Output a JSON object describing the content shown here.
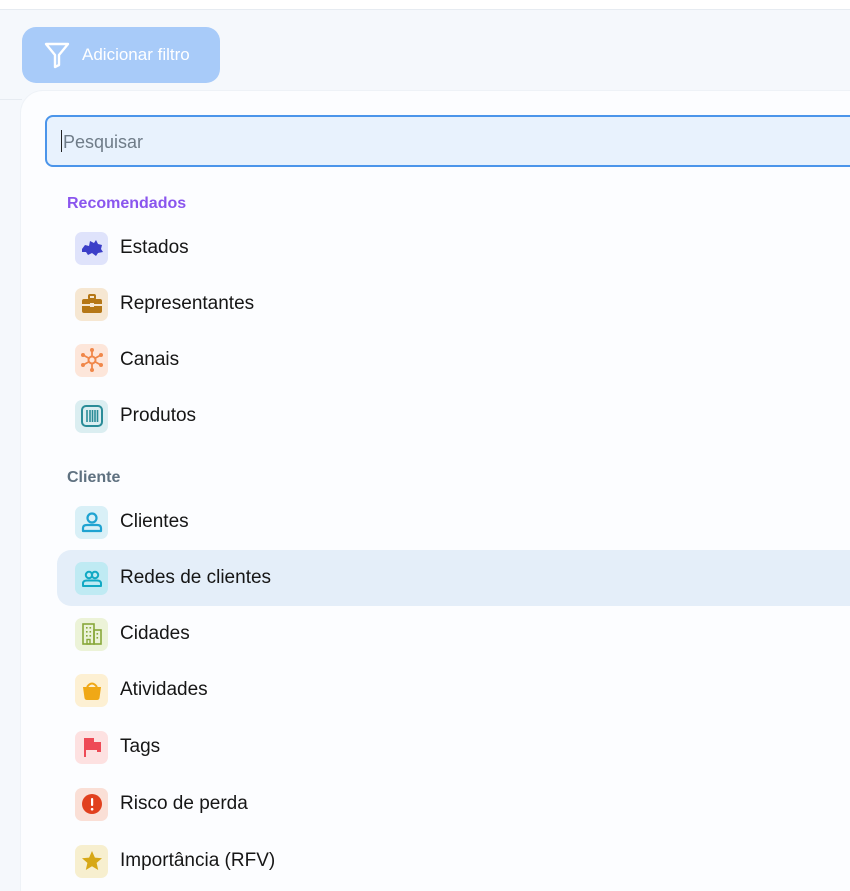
{
  "toolbar": {
    "add_filter_label": "Adicionar filtro"
  },
  "search": {
    "placeholder": "Pesquisar",
    "value": ""
  },
  "sections": [
    {
      "title": "Recomendados",
      "items": [
        {
          "label": "Estados",
          "icon": "map-region-icon",
          "icon_bg": "#dfe3fb",
          "icon_color": "#3b3ec8"
        },
        {
          "label": "Representantes",
          "icon": "briefcase-icon",
          "icon_bg": "#f6e7d2",
          "icon_color": "#b57716"
        },
        {
          "label": "Canais",
          "icon": "network-hub-icon",
          "icon_bg": "#fde6da",
          "icon_color": "#f0874a"
        },
        {
          "label": "Produtos",
          "icon": "barcode-icon",
          "icon_bg": "#dbeef1",
          "icon_color": "#2a8c98"
        }
      ]
    },
    {
      "title": "Cliente",
      "items": [
        {
          "label": "Clientes",
          "icon": "user-icon",
          "icon_bg": "#d9f0f7",
          "icon_color": "#1fa3d1"
        },
        {
          "label": "Redes de clientes",
          "icon": "users-group-icon",
          "icon_bg": "#bfeaf3",
          "icon_color": "#12a9c4",
          "highlighted": true
        },
        {
          "label": "Cidades",
          "icon": "building-icon",
          "icon_bg": "#ecf3d8",
          "icon_color": "#88a83a"
        },
        {
          "label": "Atividades",
          "icon": "basket-icon",
          "icon_bg": "#fdf0d3",
          "icon_color": "#f0a816"
        },
        {
          "label": "Tags",
          "icon": "flag-icon",
          "icon_bg": "#fde1e1",
          "icon_color": "#ee4a56"
        },
        {
          "label": "Risco de perda",
          "icon": "alert-circle-icon",
          "icon_bg": "#fadfd6",
          "icon_color": "#e1401e"
        },
        {
          "label": "Importância (RFV)",
          "icon": "star-icon",
          "icon_bg": "#f7efcf",
          "icon_color": "#d7a817"
        }
      ]
    }
  ]
}
